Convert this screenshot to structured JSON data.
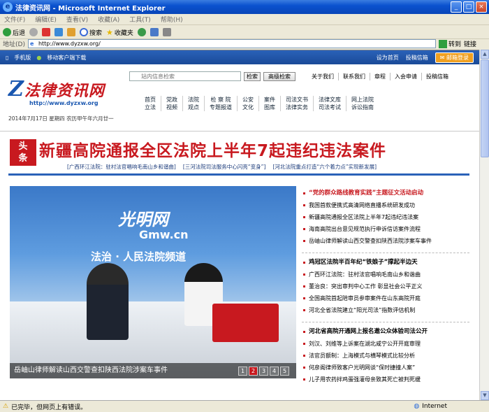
{
  "window": {
    "title": "法律资讯网 - Microsoft Internet Explorer",
    "buttons": [
      "_",
      "□",
      "×"
    ]
  },
  "menu": [
    "文件(F)",
    "编辑(E)",
    "查看(V)",
    "收藏(A)",
    "工具(T)",
    "帮助(H)"
  ],
  "toolbar": {
    "back": "后退",
    "search": "搜索",
    "favorites": "收藏夹"
  },
  "address": {
    "label": "地址(D)",
    "url": "http://www.dyzxw.org/",
    "go": "转到",
    "links": "链接"
  },
  "status": {
    "text": "已完毕，但网页上有错误。",
    "zone": "Internet"
  },
  "site": {
    "strip": {
      "mobile": "手机版",
      "client": "移动客户端下载",
      "home": "设为首页",
      "submit": "投稿信箱",
      "mail": "邮箱登录"
    },
    "logo": {
      "name": "法律资讯网",
      "url": "http://www.dyzxw.org"
    },
    "date": "2014年7月17日  星期四 农历甲午年六月廿一",
    "search": {
      "placeholder": "站内信息检索",
      "button": "检索",
      "advanced": "高级检索"
    },
    "toplinks": [
      "关于我们",
      "联系我们",
      "章程",
      "入会申请",
      "投稿信箱"
    ],
    "nav": [
      [
        "首页",
        "立法"
      ],
      [
        "党政",
        "视频"
      ],
      [
        "法院",
        "观点"
      ],
      [
        "检 察 院",
        "专题报道"
      ],
      [
        "公安",
        "文化"
      ],
      [
        "案件",
        "图库"
      ],
      [
        "司法文书",
        "法律实务"
      ],
      [
        "法律文库",
        "司法考试"
      ],
      [
        "网上法院",
        "诉讼指南"
      ]
    ]
  },
  "headline": {
    "tag": "头条",
    "title": "新疆高院通报全区法院上半年7起违纪违法案件",
    "subs": [
      "[广西环江法院：驻村法官唱响毛南山乡和谐曲]",
      "[三河法院司法服务中心闪亮“变身”]",
      "[河北法院重点打造“六个着力点”实现新发展]"
    ]
  },
  "hero": {
    "brand": "光明网",
    "brand_sub": "Gmw.cn",
    "banner": "法治 · 人民法院频道",
    "caption": "岳岫山律师解读山西交警查扣陕西法院涉案车事件",
    "pages": [
      "1",
      "2",
      "3",
      "4",
      "5"
    ],
    "active_page": "2"
  },
  "news": [
    [
      "“党的群众路线教育实践”主题征文活动启动",
      "我国首款便携式高清网络直播系统研发成功",
      "新疆高院通报全区法院上半年7起违纪违法案",
      "海南高院出台意见规范执行申诉信访案件流程",
      "岳岫山律师解读山西交警查扣陕西法院涉案车事件"
    ],
    [
      "鸡冠区法院半百年纪“铁娘子”撑起半边天",
      "广西环江法院：驻村法官唱响毛南山乡和谐曲",
      "董治良：突出审判中心工作  彰显社会公平正义",
      "全国高院首起陪审员参审案件在山东高院开庭",
      "河北全省法院建立“阳光司法”指数评估机制"
    ],
    [
      "河北省高院开通网上报名邀公众体验司法公开",
      "刘汉、刘维等上诉案在湖北咸宁公开开庭审理",
      "法官员额制：上海模式与横琴模式比较分析",
      "何彦阁律师致客户光明网谈“保时捷撞人案”",
      "儿子用农药拌鸡蛋强灌母亲致其死亡被判死缓"
    ]
  ]
}
